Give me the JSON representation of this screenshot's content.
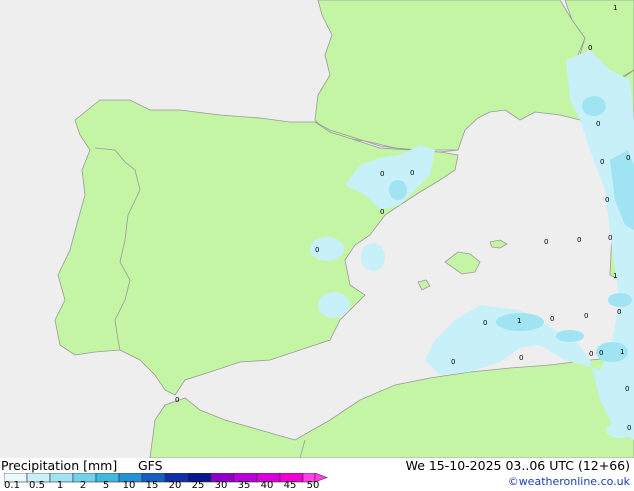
{
  "legend": {
    "title": "Precipitation [mm]",
    "model": "GFS",
    "valid": "We 15-10-2025 03..06 UTC (12+66)",
    "credit": "©weatheronline.co.uk",
    "ticks": [
      "0.1",
      "0.5",
      "1",
      "2",
      "5",
      "10",
      "15",
      "20",
      "25",
      "30",
      "35",
      "40",
      "45",
      "50"
    ],
    "colors": [
      "#e8fafc",
      "#c8f0f8",
      "#a0e4f4",
      "#70d2ec",
      "#40b8e0",
      "#2890d4",
      "#1860c0",
      "#1030a8",
      "#081890",
      "#9000c8",
      "#b800d8",
      "#d800d8",
      "#f000d0",
      "#ff40e8"
    ]
  },
  "map": {
    "land_color": "#c4f5a4",
    "sea_color": "#eeeeee",
    "border_color": "#999999"
  },
  "points": [
    "0",
    "0",
    "0",
    "0",
    "0",
    "1",
    "0",
    "0",
    "0",
    "0",
    "1",
    "0",
    "0",
    "0",
    "0",
    "0",
    "1",
    "0",
    "0",
    "0",
    "0",
    "0",
    "1",
    "0",
    "0",
    "0",
    "0"
  ]
}
